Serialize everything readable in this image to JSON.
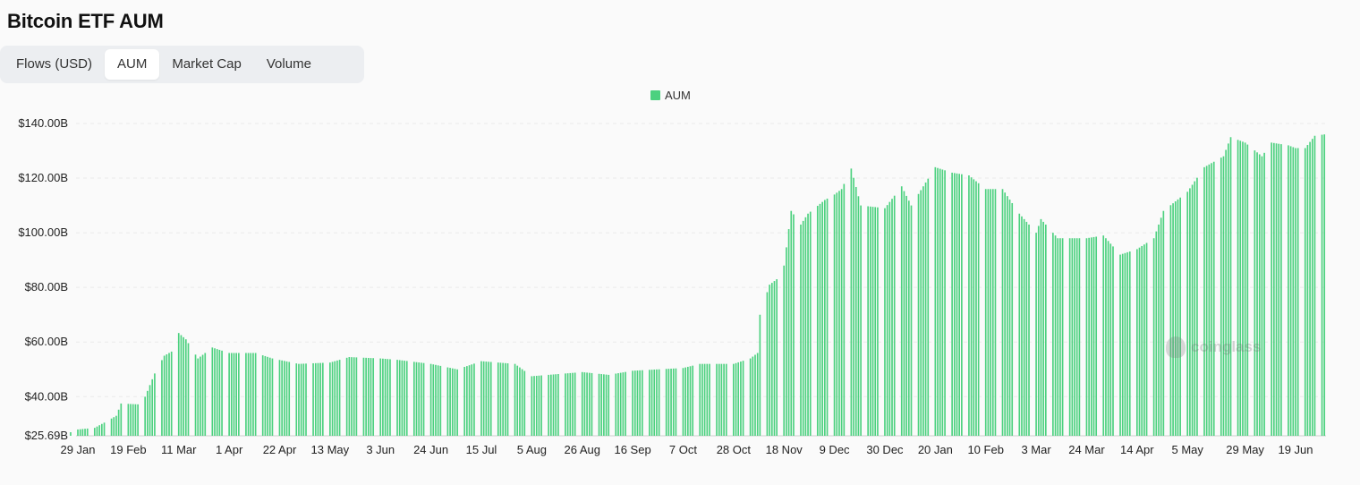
{
  "title": "Bitcoin ETF AUM",
  "tabs": [
    {
      "label": "Flows (USD)",
      "active": false
    },
    {
      "label": "AUM",
      "active": true
    },
    {
      "label": "Market Cap",
      "active": false
    },
    {
      "label": "Volume",
      "active": false
    }
  ],
  "watermark": "coinglass",
  "chart_data": {
    "type": "bar",
    "title": "",
    "legend": {
      "entries": [
        "AUM"
      ],
      "placement": "top-center"
    },
    "series": [
      {
        "name": "AUM",
        "color": "#4cd17f"
      }
    ],
    "y_min": 25.69,
    "ylim": [
      25.69,
      140
    ],
    "yticks": [
      {
        "value": 140,
        "label": "$140.00B"
      },
      {
        "value": 120,
        "label": "$120.00B"
      },
      {
        "value": 100,
        "label": "$100.00B"
      },
      {
        "value": 80,
        "label": "$80.00B"
      },
      {
        "value": 60,
        "label": "$60.00B"
      },
      {
        "value": 40,
        "label": "$40.00B"
      },
      {
        "value": 25.69,
        "label": "$25.69B"
      }
    ],
    "grid": true,
    "xticks": [
      {
        "date": "2024-01-29",
        "label": "29 Jan"
      },
      {
        "date": "2024-02-19",
        "label": "19 Feb"
      },
      {
        "date": "2024-03-11",
        "label": "11 Mar"
      },
      {
        "date": "2024-04-01",
        "label": "1 Apr"
      },
      {
        "date": "2024-04-22",
        "label": "22 Apr"
      },
      {
        "date": "2024-05-13",
        "label": "13 May"
      },
      {
        "date": "2024-06-03",
        "label": "3 Jun"
      },
      {
        "date": "2024-06-24",
        "label": "24 Jun"
      },
      {
        "date": "2024-07-15",
        "label": "15 Jul"
      },
      {
        "date": "2024-08-05",
        "label": "5 Aug"
      },
      {
        "date": "2024-08-26",
        "label": "26 Aug"
      },
      {
        "date": "2024-09-16",
        "label": "16 Sep"
      },
      {
        "date": "2024-10-07",
        "label": "7 Oct"
      },
      {
        "date": "2024-10-28",
        "label": "28 Oct"
      },
      {
        "date": "2024-11-18",
        "label": "18 Nov"
      },
      {
        "date": "2024-12-09",
        "label": "9 Dec"
      },
      {
        "date": "2024-12-30",
        "label": "30 Dec"
      },
      {
        "date": "2025-01-20",
        "label": "20 Jan"
      },
      {
        "date": "2025-02-10",
        "label": "10 Feb"
      },
      {
        "date": "2025-03-03",
        "label": "3 Mar"
      },
      {
        "date": "2025-03-24",
        "label": "24 Mar"
      },
      {
        "date": "2025-04-14",
        "label": "14 Apr"
      },
      {
        "date": "2025-05-05",
        "label": "5 May"
      },
      {
        "date": "2025-05-29",
        "label": "29 May"
      },
      {
        "date": "2025-06-19",
        "label": "19 Jun"
      }
    ],
    "data": [
      [
        "2024-01-26",
        27.0
      ],
      [
        "2024-01-29",
        28.0
      ],
      [
        "2024-02-05",
        28.6
      ],
      [
        "2024-02-09",
        30.5
      ],
      [
        "2024-02-14",
        33.0
      ],
      [
        "2024-02-16",
        37.5
      ],
      [
        "2024-02-23",
        37.2
      ],
      [
        "2024-02-26",
        40.0
      ],
      [
        "2024-03-01",
        48.5
      ],
      [
        "2024-03-05",
        55.0
      ],
      [
        "2024-03-08",
        56.5
      ],
      [
        "2024-03-11",
        63.3
      ],
      [
        "2024-03-14",
        61.0
      ],
      [
        "2024-03-19",
        54.0
      ],
      [
        "2024-03-25",
        58.0
      ],
      [
        "2024-04-01",
        56.0
      ],
      [
        "2024-04-12",
        56.0
      ],
      [
        "2024-04-19",
        54.0
      ],
      [
        "2024-04-30",
        52.0
      ],
      [
        "2024-05-13",
        52.5
      ],
      [
        "2024-05-21",
        54.5
      ],
      [
        "2024-06-03",
        54.0
      ],
      [
        "2024-06-10",
        53.5
      ],
      [
        "2024-06-24",
        52.0
      ],
      [
        "2024-07-05",
        50.0
      ],
      [
        "2024-07-15",
        53.0
      ],
      [
        "2024-07-29",
        52.0
      ],
      [
        "2024-08-05",
        47.5
      ],
      [
        "2024-08-26",
        49.0
      ],
      [
        "2024-09-06",
        48.0
      ],
      [
        "2024-09-16",
        49.5
      ],
      [
        "2024-10-07",
        50.5
      ],
      [
        "2024-10-14",
        52.0
      ],
      [
        "2024-10-28",
        52.0
      ],
      [
        "2024-11-04",
        54.0
      ],
      [
        "2024-11-07",
        56.0
      ],
      [
        "2024-11-08",
        70.0
      ],
      [
        "2024-11-12",
        81.0
      ],
      [
        "2024-11-15",
        83.0
      ],
      [
        "2024-11-18",
        88.0
      ],
      [
        "2024-11-21",
        108.0
      ],
      [
        "2024-11-25",
        103.0
      ],
      [
        "2024-11-28",
        107.0
      ],
      [
        "2024-12-05",
        112.0
      ],
      [
        "2024-12-09",
        114.0
      ],
      [
        "2024-12-12",
        116.0
      ],
      [
        "2024-12-16",
        123.5
      ],
      [
        "2024-12-20",
        110.0
      ],
      [
        "2024-12-30",
        109.0
      ],
      [
        "2025-01-06",
        117.0
      ],
      [
        "2025-01-10",
        110.0
      ],
      [
        "2025-01-20",
        124.0
      ],
      [
        "2025-01-27",
        122.0
      ],
      [
        "2025-02-03",
        121.0
      ],
      [
        "2025-02-10",
        116.0
      ],
      [
        "2025-02-17",
        116.0
      ],
      [
        "2025-02-24",
        107.0
      ],
      [
        "2025-03-03",
        100.0
      ],
      [
        "2025-03-05",
        105.0
      ],
      [
        "2025-03-12",
        98.0
      ],
      [
        "2025-03-24",
        98.0
      ],
      [
        "2025-03-31",
        99.0
      ],
      [
        "2025-04-07",
        92.0
      ],
      [
        "2025-04-14",
        94.0
      ],
      [
        "2025-04-21",
        98.0
      ],
      [
        "2025-04-25",
        108.0
      ],
      [
        "2025-05-05",
        115.0
      ],
      [
        "2025-05-12",
        124.0
      ],
      [
        "2025-05-20",
        128.0
      ],
      [
        "2025-05-23",
        135.0
      ],
      [
        "2025-05-29",
        133.0
      ],
      [
        "2025-06-05",
        128.0
      ],
      [
        "2025-06-09",
        133.0
      ],
      [
        "2025-06-16",
        132.0
      ],
      [
        "2025-06-19",
        131.0
      ],
      [
        "2025-06-23",
        131.0
      ],
      [
        "2025-06-27",
        135.5
      ],
      [
        "2025-07-01",
        136.0
      ]
    ]
  }
}
